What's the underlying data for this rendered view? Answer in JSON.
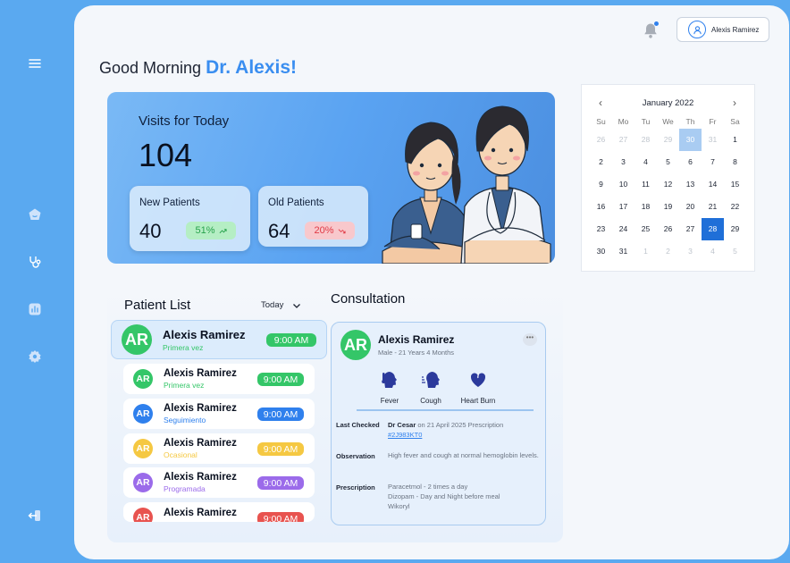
{
  "user": {
    "name": "Alexis Ramirez"
  },
  "greeting": {
    "prefix": "Good Morning ",
    "name": "Dr. Alexis!"
  },
  "visits": {
    "label": "Visits for Today",
    "value": "104",
    "new_patients": {
      "label": "New Patients",
      "value": "40",
      "change": "51%"
    },
    "old_patients": {
      "label": "Old Patients",
      "value": "64",
      "change": "20%"
    }
  },
  "calendar": {
    "month": "January 2022",
    "weekdays": [
      "Su",
      "Mo",
      "Tu",
      "We",
      "Th",
      "Fr",
      "Sa"
    ],
    "days": [
      {
        "d": "26",
        "muted": true
      },
      {
        "d": "27",
        "muted": true
      },
      {
        "d": "28",
        "muted": true
      },
      {
        "d": "29",
        "muted": true
      },
      {
        "d": "30",
        "muted": true,
        "sel": "light"
      },
      {
        "d": "31",
        "muted": true
      },
      {
        "d": "1"
      },
      {
        "d": "2"
      },
      {
        "d": "3"
      },
      {
        "d": "4"
      },
      {
        "d": "5"
      },
      {
        "d": "6"
      },
      {
        "d": "7"
      },
      {
        "d": "8"
      },
      {
        "d": "9"
      },
      {
        "d": "10"
      },
      {
        "d": "11"
      },
      {
        "d": "12"
      },
      {
        "d": "13"
      },
      {
        "d": "14"
      },
      {
        "d": "15"
      },
      {
        "d": "16"
      },
      {
        "d": "17"
      },
      {
        "d": "18"
      },
      {
        "d": "19"
      },
      {
        "d": "20"
      },
      {
        "d": "21"
      },
      {
        "d": "22"
      },
      {
        "d": "23"
      },
      {
        "d": "24"
      },
      {
        "d": "25"
      },
      {
        "d": "26"
      },
      {
        "d": "27"
      },
      {
        "d": "28"
      },
      {
        "d": "29"
      },
      {
        "d": "30"
      },
      {
        "d": "31"
      },
      {
        "d": "1",
        "muted": true
      },
      {
        "d": "2",
        "muted": true
      },
      {
        "d": "3",
        "muted": true
      },
      {
        "d": "4",
        "muted": true
      },
      {
        "d": "5",
        "muted": true
      }
    ],
    "selected_day": "28"
  },
  "patient_list": {
    "title": "Patient List",
    "filter": "Today",
    "patients": [
      {
        "initials": "AR",
        "name": "Alexis Ramirez",
        "type": "Primera vez",
        "time": "9:00 AM",
        "color": "#34c668"
      },
      {
        "initials": "AR",
        "name": "Alexis Ramirez",
        "type": "Primera vez",
        "time": "9:00 AM",
        "color": "#34c668"
      },
      {
        "initials": "AR",
        "name": "Alexis Ramirez",
        "type": "Seguimiento",
        "time": "9:00 AM",
        "color": "#2f80ed"
      },
      {
        "initials": "AR",
        "name": "Alexis Ramirez",
        "type": "Ocasional",
        "time": "9:00 AM",
        "color": "#f5c842"
      },
      {
        "initials": "AR",
        "name": "Alexis Ramirez",
        "type": "Programada",
        "time": "9:00 AM",
        "color": "#9b6bea"
      },
      {
        "initials": "AR",
        "name": "Alexis Ramirez",
        "type": "",
        "time": "9:00 AM",
        "color": "#e8534f"
      }
    ]
  },
  "consultation": {
    "title": "Consultation",
    "initials": "AR",
    "name": "Alexis Ramirez",
    "meta": "Male - 21 Years 4 Months",
    "symptoms": [
      "Fever",
      "Cough",
      "Heart Burn"
    ],
    "last_checked_label": "Last Checked",
    "last_checked_doctor": "Dr Cesar",
    "last_checked_text": " on 21 April 2025 Prescription",
    "prescription_id": "#2J983KT0",
    "observation_label": "Observation",
    "observation_text": "High fever and cough at normal hemoglobin levels.",
    "prescription_label": "Prescription",
    "prescription_lines": [
      "Paracetmol - 2 times a day",
      "Dizopam - Day and Night before meal",
      "Wikoryl"
    ]
  },
  "colors": {
    "accent": "#3a8ef0",
    "sidebar": "#5aa9f0",
    "selected": "#1f6fd8"
  }
}
